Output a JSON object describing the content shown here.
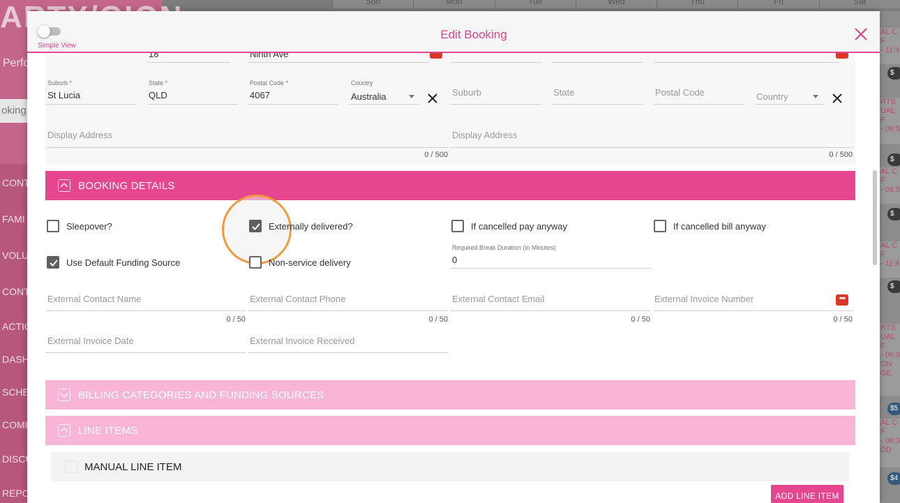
{
  "background": {
    "brand": "ARTY/GION",
    "subtitle": "Perfo",
    "search_placeholder": "oking fo",
    "nav_items": [
      "CONT",
      "FAMI",
      "VOLU",
      "CONT",
      "ACTIO",
      "DASH",
      "SCHE",
      "COMI",
      "DISCU",
      "REPO"
    ],
    "calendar_days": [
      "Sun",
      "Mon",
      "Tue",
      "Wed",
      "Thu",
      "Fri",
      "Sat"
    ],
    "events": [
      {
        "lines": [
          "AL C",
          "F",
          "- 11:4"
        ],
        "badge": "$"
      },
      {
        "lines": [
          "RTS",
          "UAL",
          "F",
          "- 06:5"
        ],
        "badge": "$"
      },
      {
        "lines": [
          "AL C",
          "F",
          "- 06:5"
        ],
        "badge": "$"
      },
      {
        "lines": [
          "AL C",
          "F",
          "- 11:4"
        ],
        "badge": "$"
      },
      {
        "lines": [
          "RTS",
          "UAL",
          "F",
          "- 06:0",
          "ON",
          "GE"
        ],
        "badge": "$5"
      },
      {
        "lines": [
          "AL C",
          "F",
          "- 06:3",
          "DD"
        ],
        "badge": "$4"
      }
    ]
  },
  "modal": {
    "title": "Edit Booking",
    "simple_view_label": "Simple View",
    "simple_view_on": false
  },
  "address": {
    "top_row": {
      "street_number": "18",
      "street_name": "Ninth Ave"
    },
    "left": {
      "suburb_label": "Suburb *",
      "suburb_value": "St Lucia",
      "state_label": "State *",
      "state_value": "QLD",
      "postal_label": "Postal Code *",
      "postal_value": "4067",
      "country_label": "Country",
      "country_value": "Australia",
      "display_address_placeholder": "Display Address",
      "display_address_counter": "0 / 500"
    },
    "right": {
      "suburb_placeholder": "Suburb",
      "state_placeholder": "State",
      "postal_placeholder": "Postal Code",
      "country_placeholder": "Country",
      "display_address_placeholder": "Display Address",
      "display_address_counter": "0 / 500"
    }
  },
  "booking_details": {
    "title": "BOOKING DETAILS",
    "checkboxes": {
      "sleepover": {
        "label": "Sleepover?",
        "checked": false
      },
      "externally_delivered": {
        "label": "Externally delivered?",
        "checked": true
      },
      "cancelled_pay": {
        "label": "If cancelled pay anyway",
        "checked": false
      },
      "cancelled_bill": {
        "label": "If cancelled bill anyway",
        "checked": false
      },
      "default_funding": {
        "label": "Use Default Funding Source",
        "checked": true
      },
      "non_service": {
        "label": "Non-service delivery",
        "checked": false
      }
    },
    "break_duration": {
      "label": "Required Break Duration (in Minutes)",
      "value": "0"
    },
    "external_fields": {
      "contact_name": {
        "placeholder": "External Contact Name",
        "counter": "0 / 50"
      },
      "contact_phone": {
        "placeholder": "External Contact Phone",
        "counter": "0 / 50"
      },
      "contact_email": {
        "placeholder": "External Contact Email",
        "counter": "0 / 50"
      },
      "invoice_number": {
        "placeholder": "External Invoice Number",
        "counter": "0 / 50"
      },
      "invoice_date": {
        "placeholder": "External Invoice Date"
      },
      "invoice_received": {
        "placeholder": "External Invoice Received"
      }
    }
  },
  "sections": {
    "billing": "BILLING CATEGORIES AND FUNDING SOURCES",
    "line_items": "LINE ITEMS",
    "manual_line_item": "MANUAL LINE ITEM",
    "add_line_item": "ADD LINE ITEM"
  },
  "colors": {
    "accent": "#e64590",
    "accent_light": "#f9b5d6",
    "highlight_ring": "#f29a3f",
    "danger": "#d9362c"
  }
}
